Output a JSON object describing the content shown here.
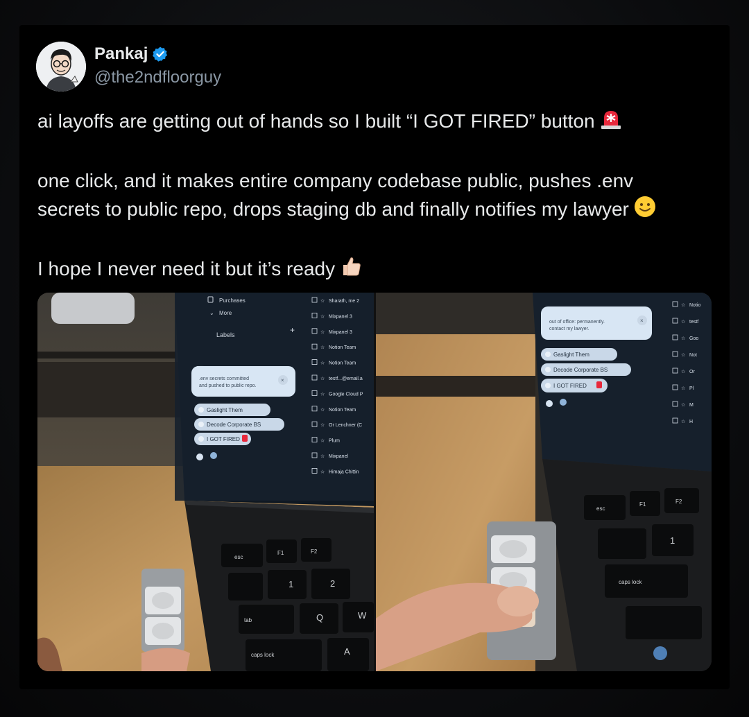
{
  "author": {
    "name": "Pankaj",
    "handle": "@the2ndfloorguy",
    "verified": true,
    "verified_color": "#1d9bf0"
  },
  "tweet": {
    "line1": "ai layoffs are getting out of hands so I built “I GOT FIRED” button",
    "line2": "one click, and it makes entire company codebase public, pushes .env",
    "line3": "secrets to public repo, drops staging db and finally notifies my lawyer",
    "line4": " I hope I never need it but it’s ready",
    "emojis": [
      "rotating-light-icon",
      "smiling-face-icon",
      "thumbs-up-icon"
    ]
  },
  "photo_left": {
    "sidebar": {
      "purchases": "Purchases",
      "more": "More",
      "labels": "Labels"
    },
    "notification": ".env secrets committed and pushed to public repo.",
    "chips": [
      "Gaslight Them",
      "Decode Corporate BS",
      "I GOT FIRED"
    ],
    "emails": [
      "Sharath, me 2",
      "Mixpanel 3",
      "Mixpanel 3",
      "Notion Team",
      "Notion Team",
      "testf...@email.a",
      "Google Cloud P",
      "Notion Team",
      "Or Lenchner (C",
      "Plum",
      "Mixpanel",
      "Himaja Chittin"
    ],
    "keys": [
      "esc",
      "F1",
      "F2",
      "1",
      "2",
      "Q",
      "W",
      "A",
      "tab",
      "caps lock"
    ]
  },
  "photo_right": {
    "notification": "out of office: permanently. contact my lawyer.",
    "chips": [
      "Gaslight Them",
      "Decode Corporate BS",
      "I GOT FIRED"
    ],
    "emails": [
      "Notio",
      "testf",
      "Goo",
      "Not",
      "Or",
      "Pl",
      "M",
      "H"
    ],
    "keys": [
      "esc",
      "F1",
      "F2",
      "1",
      "caps lock"
    ]
  }
}
